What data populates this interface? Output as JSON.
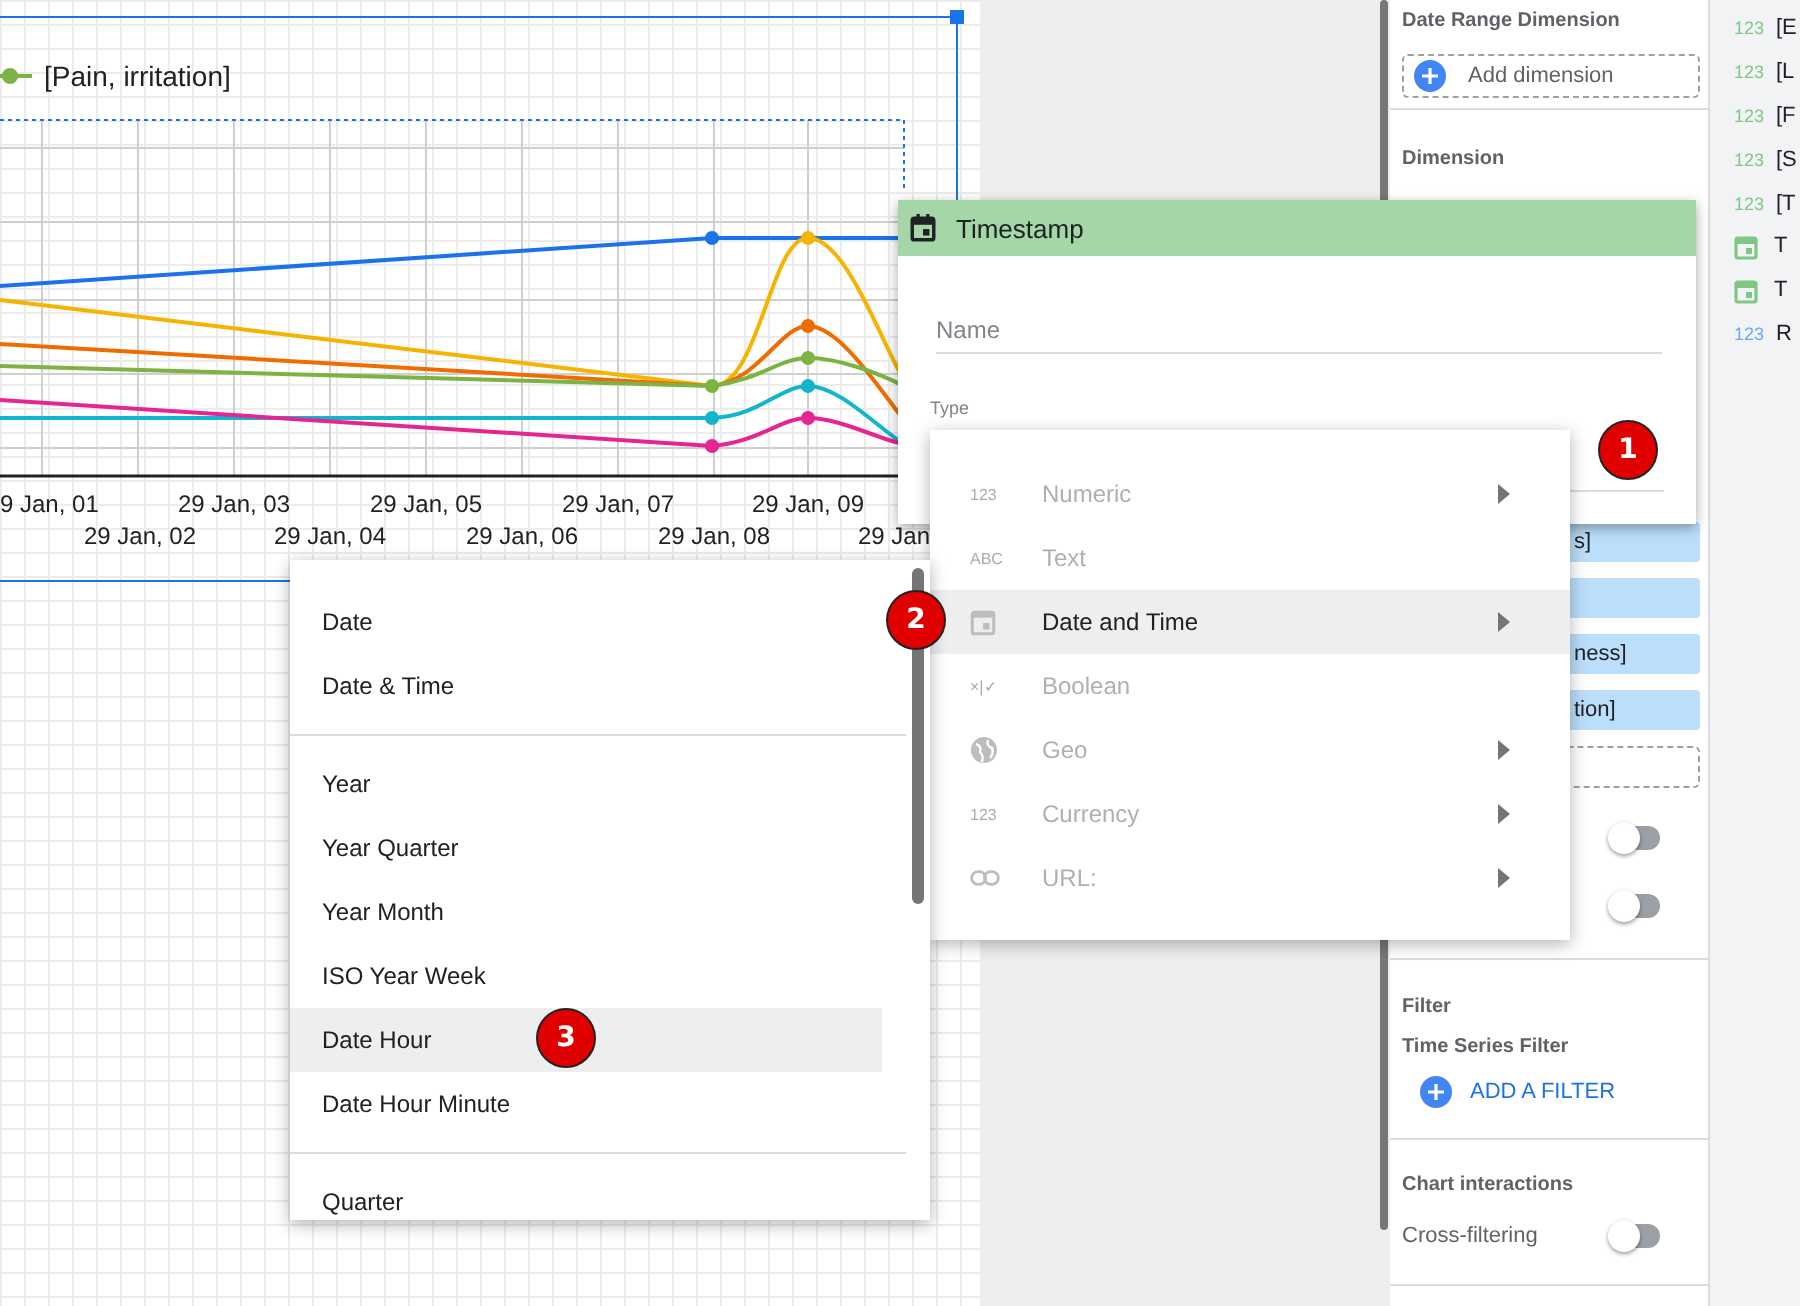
{
  "chart": {
    "legend": [
      {
        "label": "[Pain, irritation]",
        "color": "#7cb342"
      }
    ],
    "x_labels_top": [
      "9 Jan, 01",
      "29 Jan, 03",
      "29 Jan, 05",
      "29 Jan, 07",
      "29 Jan, 09"
    ],
    "x_labels_bottom": [
      "29 Jan, 02",
      "29 Jan, 04",
      "29 Jan, 06",
      "29 Jan, 08",
      "29 Jan"
    ]
  },
  "properties": {
    "date_range_dimension": {
      "title": "Date Range Dimension",
      "button": "Add dimension"
    },
    "dimension": {
      "title": "Dimension",
      "chips": [
        {
          "kind": "label",
          "text": "s]"
        },
        {
          "kind": "blank"
        },
        {
          "kind": "label",
          "text": "ness]"
        },
        {
          "kind": "label",
          "text": "tion]"
        }
      ],
      "toggles": [
        {
          "on": false
        },
        {
          "on": false
        }
      ]
    },
    "filter": {
      "title": "Filter",
      "subtitle": "Time Series Filter",
      "button": "ADD A FILTER"
    },
    "interactions": {
      "title": "Chart interactions",
      "items": [
        {
          "label": "Cross-filtering",
          "on": false
        }
      ]
    }
  },
  "fields": [
    {
      "kind": "dimension",
      "glyph": "123",
      "text": "[E"
    },
    {
      "kind": "dimension",
      "glyph": "123",
      "text": "[L"
    },
    {
      "kind": "dimension",
      "glyph": "123",
      "text": "[F"
    },
    {
      "kind": "dimension",
      "glyph": "123",
      "text": "[S"
    },
    {
      "kind": "dimension",
      "glyph": "123",
      "text": "[T"
    },
    {
      "kind": "date",
      "text": "T"
    },
    {
      "kind": "date",
      "text": "T"
    },
    {
      "kind": "metric",
      "glyph": "123",
      "text": "R"
    }
  ],
  "dialog": {
    "title": "Timestamp",
    "name_placeholder": "Name",
    "type_label": "Type"
  },
  "type_menu": [
    {
      "kind": "glyph",
      "glyph": "123",
      "label": "Numeric",
      "submenu": true,
      "disabled": true,
      "selected": false
    },
    {
      "kind": "glyph",
      "glyph": "ABC",
      "label": "Text",
      "submenu": false,
      "disabled": true,
      "selected": false
    },
    {
      "kind": "calendar",
      "label": "Date and Time",
      "submenu": true,
      "disabled": false,
      "selected": true
    },
    {
      "kind": "glyph",
      "glyph": "×|✓",
      "label": "Boolean",
      "submenu": false,
      "disabled": true,
      "selected": false
    },
    {
      "kind": "globe",
      "label": "Geo",
      "submenu": true,
      "disabled": true,
      "selected": false
    },
    {
      "kind": "glyph",
      "glyph": "123",
      "label": "Currency",
      "submenu": true,
      "disabled": true,
      "selected": false
    },
    {
      "kind": "link",
      "label": "URL:",
      "submenu": true,
      "disabled": true,
      "selected": false
    }
  ],
  "date_submenu": {
    "groups": [
      {
        "items": [
          {
            "label": "Date",
            "selected": false
          },
          {
            "label": "Date & Time",
            "selected": false
          }
        ]
      },
      {
        "items": [
          {
            "label": "Year",
            "selected": false
          },
          {
            "label": "Year Quarter",
            "selected": false
          },
          {
            "label": "Year Month",
            "selected": false
          },
          {
            "label": "ISO Year Week",
            "selected": false
          },
          {
            "label": "Date Hour",
            "selected": true
          },
          {
            "label": "Date Hour Minute",
            "selected": false
          }
        ]
      },
      {
        "items": [
          {
            "label": "Quarter",
            "selected": false
          }
        ]
      }
    ]
  },
  "step_badges": [
    {
      "text": "1"
    },
    {
      "text": "2"
    },
    {
      "text": "3"
    }
  ]
}
